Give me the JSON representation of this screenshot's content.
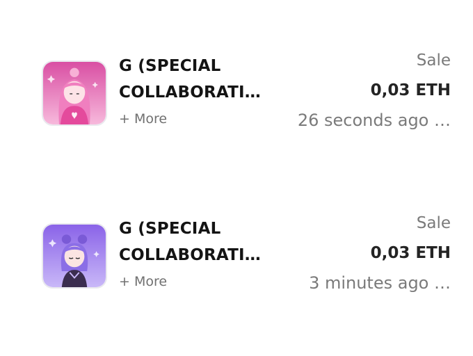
{
  "activity": [
    {
      "title_line1": "G (SPECIAL",
      "title_line2": "COLLABORATI…",
      "more_label": "+ More",
      "event": "Sale",
      "price": "0,03 ETH",
      "time": "26 seconds ago …",
      "thumbnail_icon": "pink-avatar-nft",
      "thumbnail_color": "#e86bb4"
    },
    {
      "title_line1": "G (SPECIAL",
      "title_line2": "COLLABORATI…",
      "more_label": "+ More",
      "event": "Sale",
      "price": "0,03 ETH",
      "time": "3 minutes ago …",
      "thumbnail_icon": "purple-avatar-nft",
      "thumbnail_color": "#9a7ef0"
    }
  ]
}
